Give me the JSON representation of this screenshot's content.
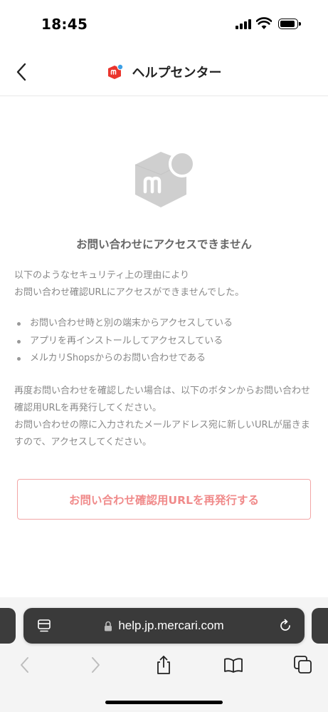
{
  "status_bar": {
    "time": "18:45"
  },
  "header": {
    "title": "ヘルプセンター"
  },
  "main": {
    "error_title": "お問い合わせにアクセスできません",
    "intro_lines": [
      "以下のようなセキュリティ上の理由により",
      "お問い合わせ確認URLにアクセスができませんでした。"
    ],
    "reasons": [
      "お問い合わせ時と別の端末からアクセスしている",
      "アプリを再インストールしてアクセスしている",
      "メルカリShopsからのお問い合わせである"
    ],
    "note_paragraphs": [
      "再度お問い合わせを確認したい場合は、以下のボタンからお問い合わせ確認用URLを再発行してください。",
      "お問い合わせの際に入力されたメールアドレス宛に新しいURLが届きますので、アクセスしてください。"
    ],
    "reissue_button_label": "お問い合わせ確認用URLを再発行する"
  },
  "browser": {
    "url": "help.jp.mercari.com"
  },
  "colors": {
    "brand_red": "#ea352d",
    "brand_blue": "#3ca0e6",
    "button_border": "#f2a6a6",
    "button_text": "#f08a8a",
    "mascot_gray": "#cfcfcf"
  },
  "icons": {
    "back": "chevron-left-icon",
    "logo": "mercari-logo-icon",
    "mascot": "mercari-box-icon",
    "lock": "lock-icon",
    "reader": "reader-mode-icon",
    "reload": "reload-icon",
    "nav_back": "chevron-left-icon",
    "nav_forward": "chevron-right-icon",
    "share": "share-icon",
    "bookmarks": "book-icon",
    "tabs": "tabs-icon"
  }
}
